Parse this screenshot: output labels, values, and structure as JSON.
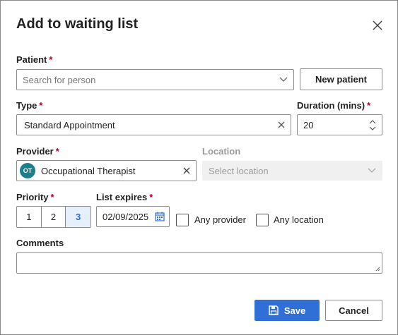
{
  "dialog": {
    "title": "Add to waiting list"
  },
  "patient": {
    "label": "Patient",
    "required": "*",
    "placeholder": "Search for person",
    "new_patient_button": "New patient"
  },
  "type": {
    "label": "Type",
    "required": "*",
    "value": "Standard Appointment"
  },
  "duration": {
    "label": "Duration (mins)",
    "required": "*",
    "value": "20"
  },
  "provider": {
    "label": "Provider",
    "required": "*",
    "initials": "OT",
    "value": "Occupational Therapist"
  },
  "location": {
    "label": "Location",
    "placeholder": "Select location"
  },
  "priority": {
    "label": "Priority",
    "required": "*",
    "options": [
      "1",
      "2",
      "3"
    ],
    "selected": "3"
  },
  "list_expires": {
    "label": "List expires",
    "required": "*",
    "value": "02/09/2025"
  },
  "any_provider": {
    "label": "Any provider",
    "checked": false
  },
  "any_location": {
    "label": "Any location",
    "checked": false
  },
  "comments": {
    "label": "Comments",
    "value": ""
  },
  "footer": {
    "save_label": "Save",
    "cancel_label": "Cancel"
  },
  "colors": {
    "primary": "#2f6fd6",
    "required": "#b00020",
    "provider_chip": "#1a7f8a"
  }
}
